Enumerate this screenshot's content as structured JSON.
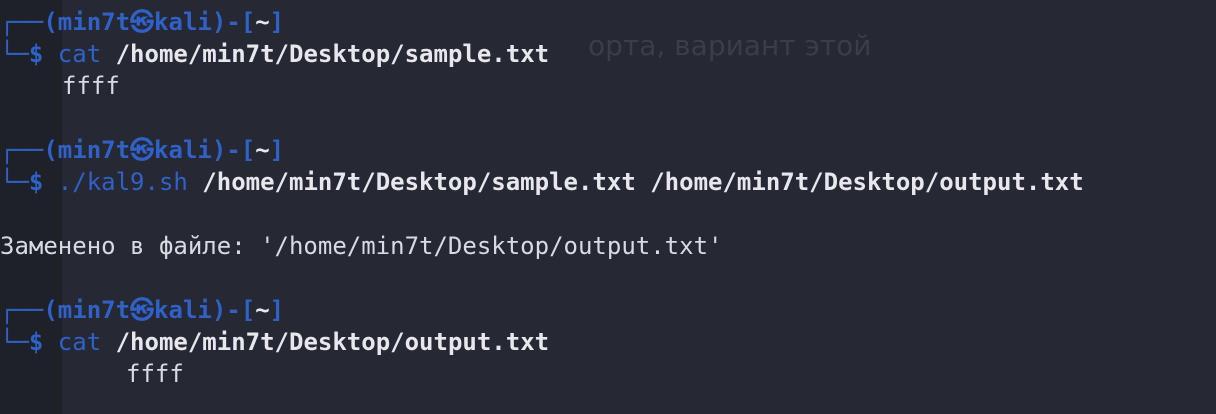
{
  "terminal": {
    "ghost_text": "орта, вариант этой",
    "prompt": {
      "user": "min7t",
      "at_symbol": "㉿",
      "host": "kali",
      "dir": "~"
    },
    "blocks": [
      {
        "command": "cat",
        "args": "/home/min7t/Desktop/sample.txt",
        "output": "ffff"
      },
      {
        "command": "./kal9.sh",
        "args": "/home/min7t/Desktop/sample.txt /home/min7t/Desktop/output.txt",
        "output": "Заменено в файле: '/home/min7t/Desktop/output.txt'"
      },
      {
        "command": "cat",
        "args": "/home/min7t/Desktop/output.txt",
        "output": "ffff"
      }
    ]
  }
}
